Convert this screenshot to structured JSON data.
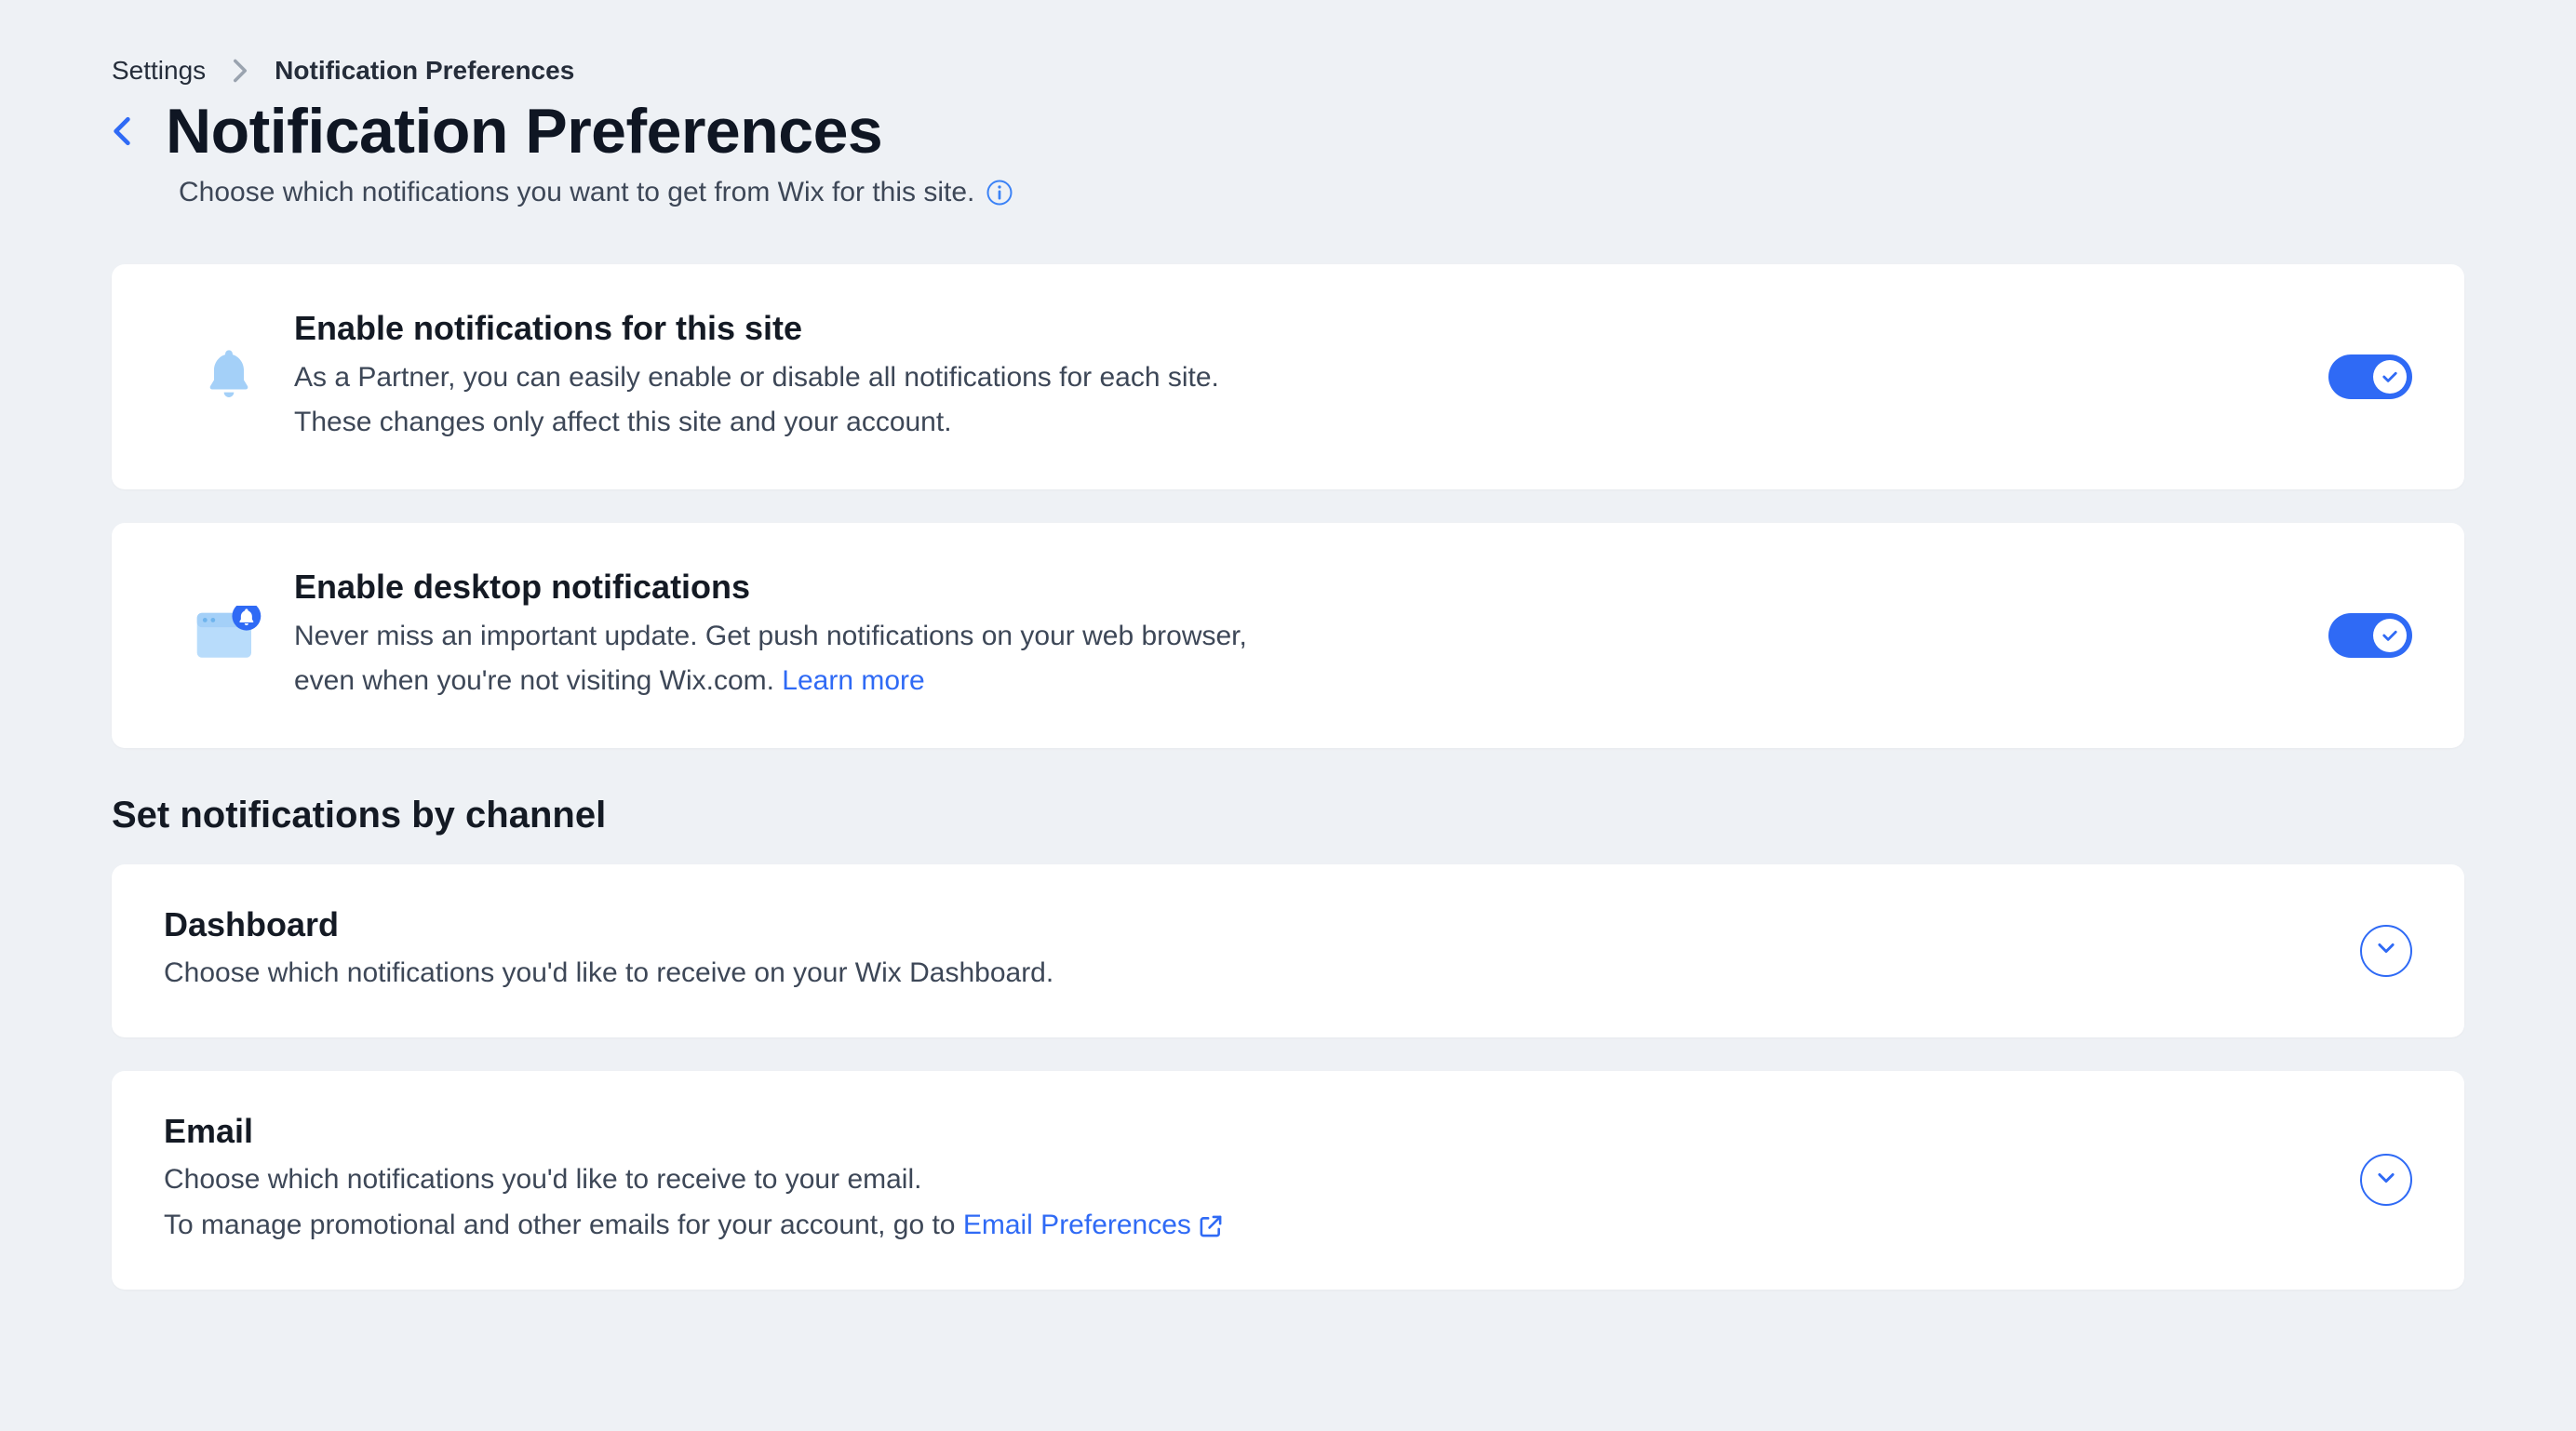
{
  "breadcrumb": {
    "root": "Settings",
    "current": "Notification Preferences"
  },
  "header": {
    "title": "Notification Preferences",
    "subtitle": "Choose which notifications you want to get from Wix for this site."
  },
  "cards": {
    "enableSite": {
      "title": "Enable notifications for this site",
      "desc1": "As a Partner, you can easily enable or disable all notifications for each site.",
      "desc2": "These changes only affect this site and your account."
    },
    "enableDesktop": {
      "title": "Enable desktop notifications",
      "desc1": "Never miss an important update. Get push notifications on your web browser,",
      "desc2_pre": "even when you're not visiting Wix.com. ",
      "learnMore": "Learn more"
    }
  },
  "section": {
    "title": "Set notifications by channel"
  },
  "channels": {
    "dashboard": {
      "title": "Dashboard",
      "desc": "Choose which notifications you'd like to receive on your Wix Dashboard."
    },
    "email": {
      "title": "Email",
      "desc1": "Choose which notifications you'd like to receive to your email.",
      "desc2_pre": "To manage promotional and other emails for your account, go to ",
      "link": "Email Preferences"
    }
  }
}
